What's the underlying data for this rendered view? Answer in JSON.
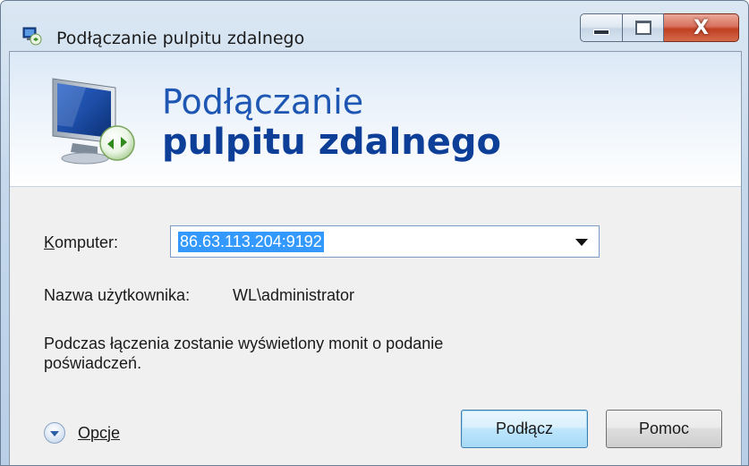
{
  "window": {
    "title": "Podłączanie pulpitu zdalnego",
    "controls": {
      "minimize": "minimize",
      "maximize": "maximize",
      "close": "X"
    }
  },
  "banner": {
    "line1": "Podłączanie",
    "line2": "pulpitu zdalnego"
  },
  "form": {
    "computer_label": "Komputer:",
    "computer_value": "86.63.113.204:9192",
    "user_label": "Nazwa użytkownika:",
    "user_value": "WL\\administrator",
    "info_text": "Podczas łączenia zostanie wyświetlony monit o podanie poświadczeń."
  },
  "footer": {
    "options_label": "Opcje",
    "connect_label": "Podłącz",
    "help_label": "Pomoc"
  },
  "icons": {
    "app": "remote-desktop-icon",
    "monitor": "monitor-icon",
    "options": "chevron-down-circle-icon",
    "combo": "dropdown-arrow-icon"
  }
}
